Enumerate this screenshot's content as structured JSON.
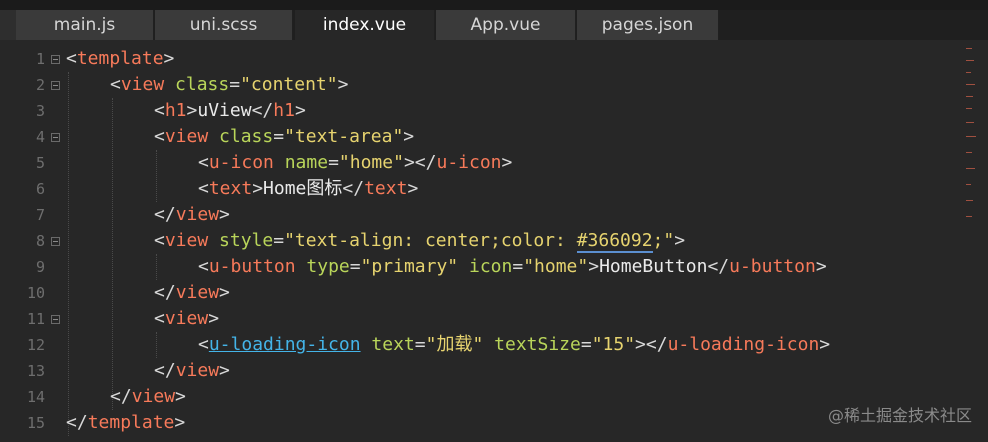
{
  "tabs": [
    {
      "label": "main.js",
      "active": false
    },
    {
      "label": "uni.scss",
      "active": false
    },
    {
      "label": "index.vue",
      "active": true
    },
    {
      "label": "App.vue",
      "active": false
    },
    {
      "label": "pages.json",
      "active": false
    }
  ],
  "line_numbers": [
    "1",
    "2",
    "3",
    "4",
    "5",
    "6",
    "7",
    "8",
    "9",
    "10",
    "11",
    "12",
    "13",
    "14",
    "15"
  ],
  "code": {
    "l1": {
      "open": "<",
      "tag": "template",
      "close": ">"
    },
    "l2": {
      "open": "<",
      "tag": "view",
      "sp": " ",
      "attr": "class",
      "eq": "=",
      "val": "\"content\"",
      "close": ">"
    },
    "l3": {
      "open": "<",
      "tag": "h1",
      "close": ">",
      "text": "uView",
      "open2": "</",
      "tag2": "h1",
      "close2": ">"
    },
    "l4": {
      "open": "<",
      "tag": "view",
      "sp": " ",
      "attr": "class",
      "eq": "=",
      "val": "\"text-area\"",
      "close": ">"
    },
    "l5": {
      "open": "<",
      "tag": "u-icon",
      "sp": " ",
      "attr": "name",
      "eq": "=",
      "val": "\"home\"",
      "close": ">",
      "open2": "</",
      "tag2": "u-icon",
      "close2": ">"
    },
    "l6": {
      "open": "<",
      "tag": "text",
      "close": ">",
      "text": "Home图标",
      "open2": "</",
      "tag2": "text",
      "close2": ">"
    },
    "l7": {
      "open": "</",
      "tag": "view",
      "close": ">"
    },
    "l8": {
      "open": "<",
      "tag": "view",
      "sp": " ",
      "attr": "style",
      "eq": "=",
      "val_a": "\"text-align: center;color: ",
      "val_hex": "#366092",
      "val_b": ";\"",
      "close": ">"
    },
    "l9": {
      "open": "<",
      "tag": "u-button",
      "sp": " ",
      "attr": "type",
      "eq": "=",
      "val": "\"primary\"",
      "sp2": " ",
      "attr2": "icon",
      "eq2": "=",
      "val2": "\"home\"",
      "close": ">",
      "text": "HomeButton",
      "open2": "</",
      "tag2": "u-button",
      "close2": ">"
    },
    "l10": {
      "open": "</",
      "tag": "view",
      "close": ">"
    },
    "l11": {
      "open": "<",
      "tag": "view",
      "close": ">"
    },
    "l12": {
      "open": "<",
      "tag": "u-loading-icon",
      "sp": " ",
      "attr": "text",
      "eq": "=",
      "val": "\"加载\"",
      "sp2": " ",
      "attr2": "textSize",
      "eq2": "=",
      "val2": "\"15\"",
      "close": ">",
      "open2": "</",
      "tag2": "u-loading-icon",
      "close2": ">"
    },
    "l13": {
      "open": "</",
      "tag": "view",
      "close": ">"
    },
    "l14": {
      "open": "</",
      "tag": "view",
      "close": ">"
    },
    "l15": {
      "open": "</",
      "tag": "template",
      "close": ">"
    }
  },
  "watermark": "@稀土掘金技术社区",
  "colors": {
    "background": "#272727",
    "tag": "#f77a5a",
    "attribute": "#b9d55a",
    "string": "#e6d36f",
    "link_underline": "#44b4e8"
  }
}
